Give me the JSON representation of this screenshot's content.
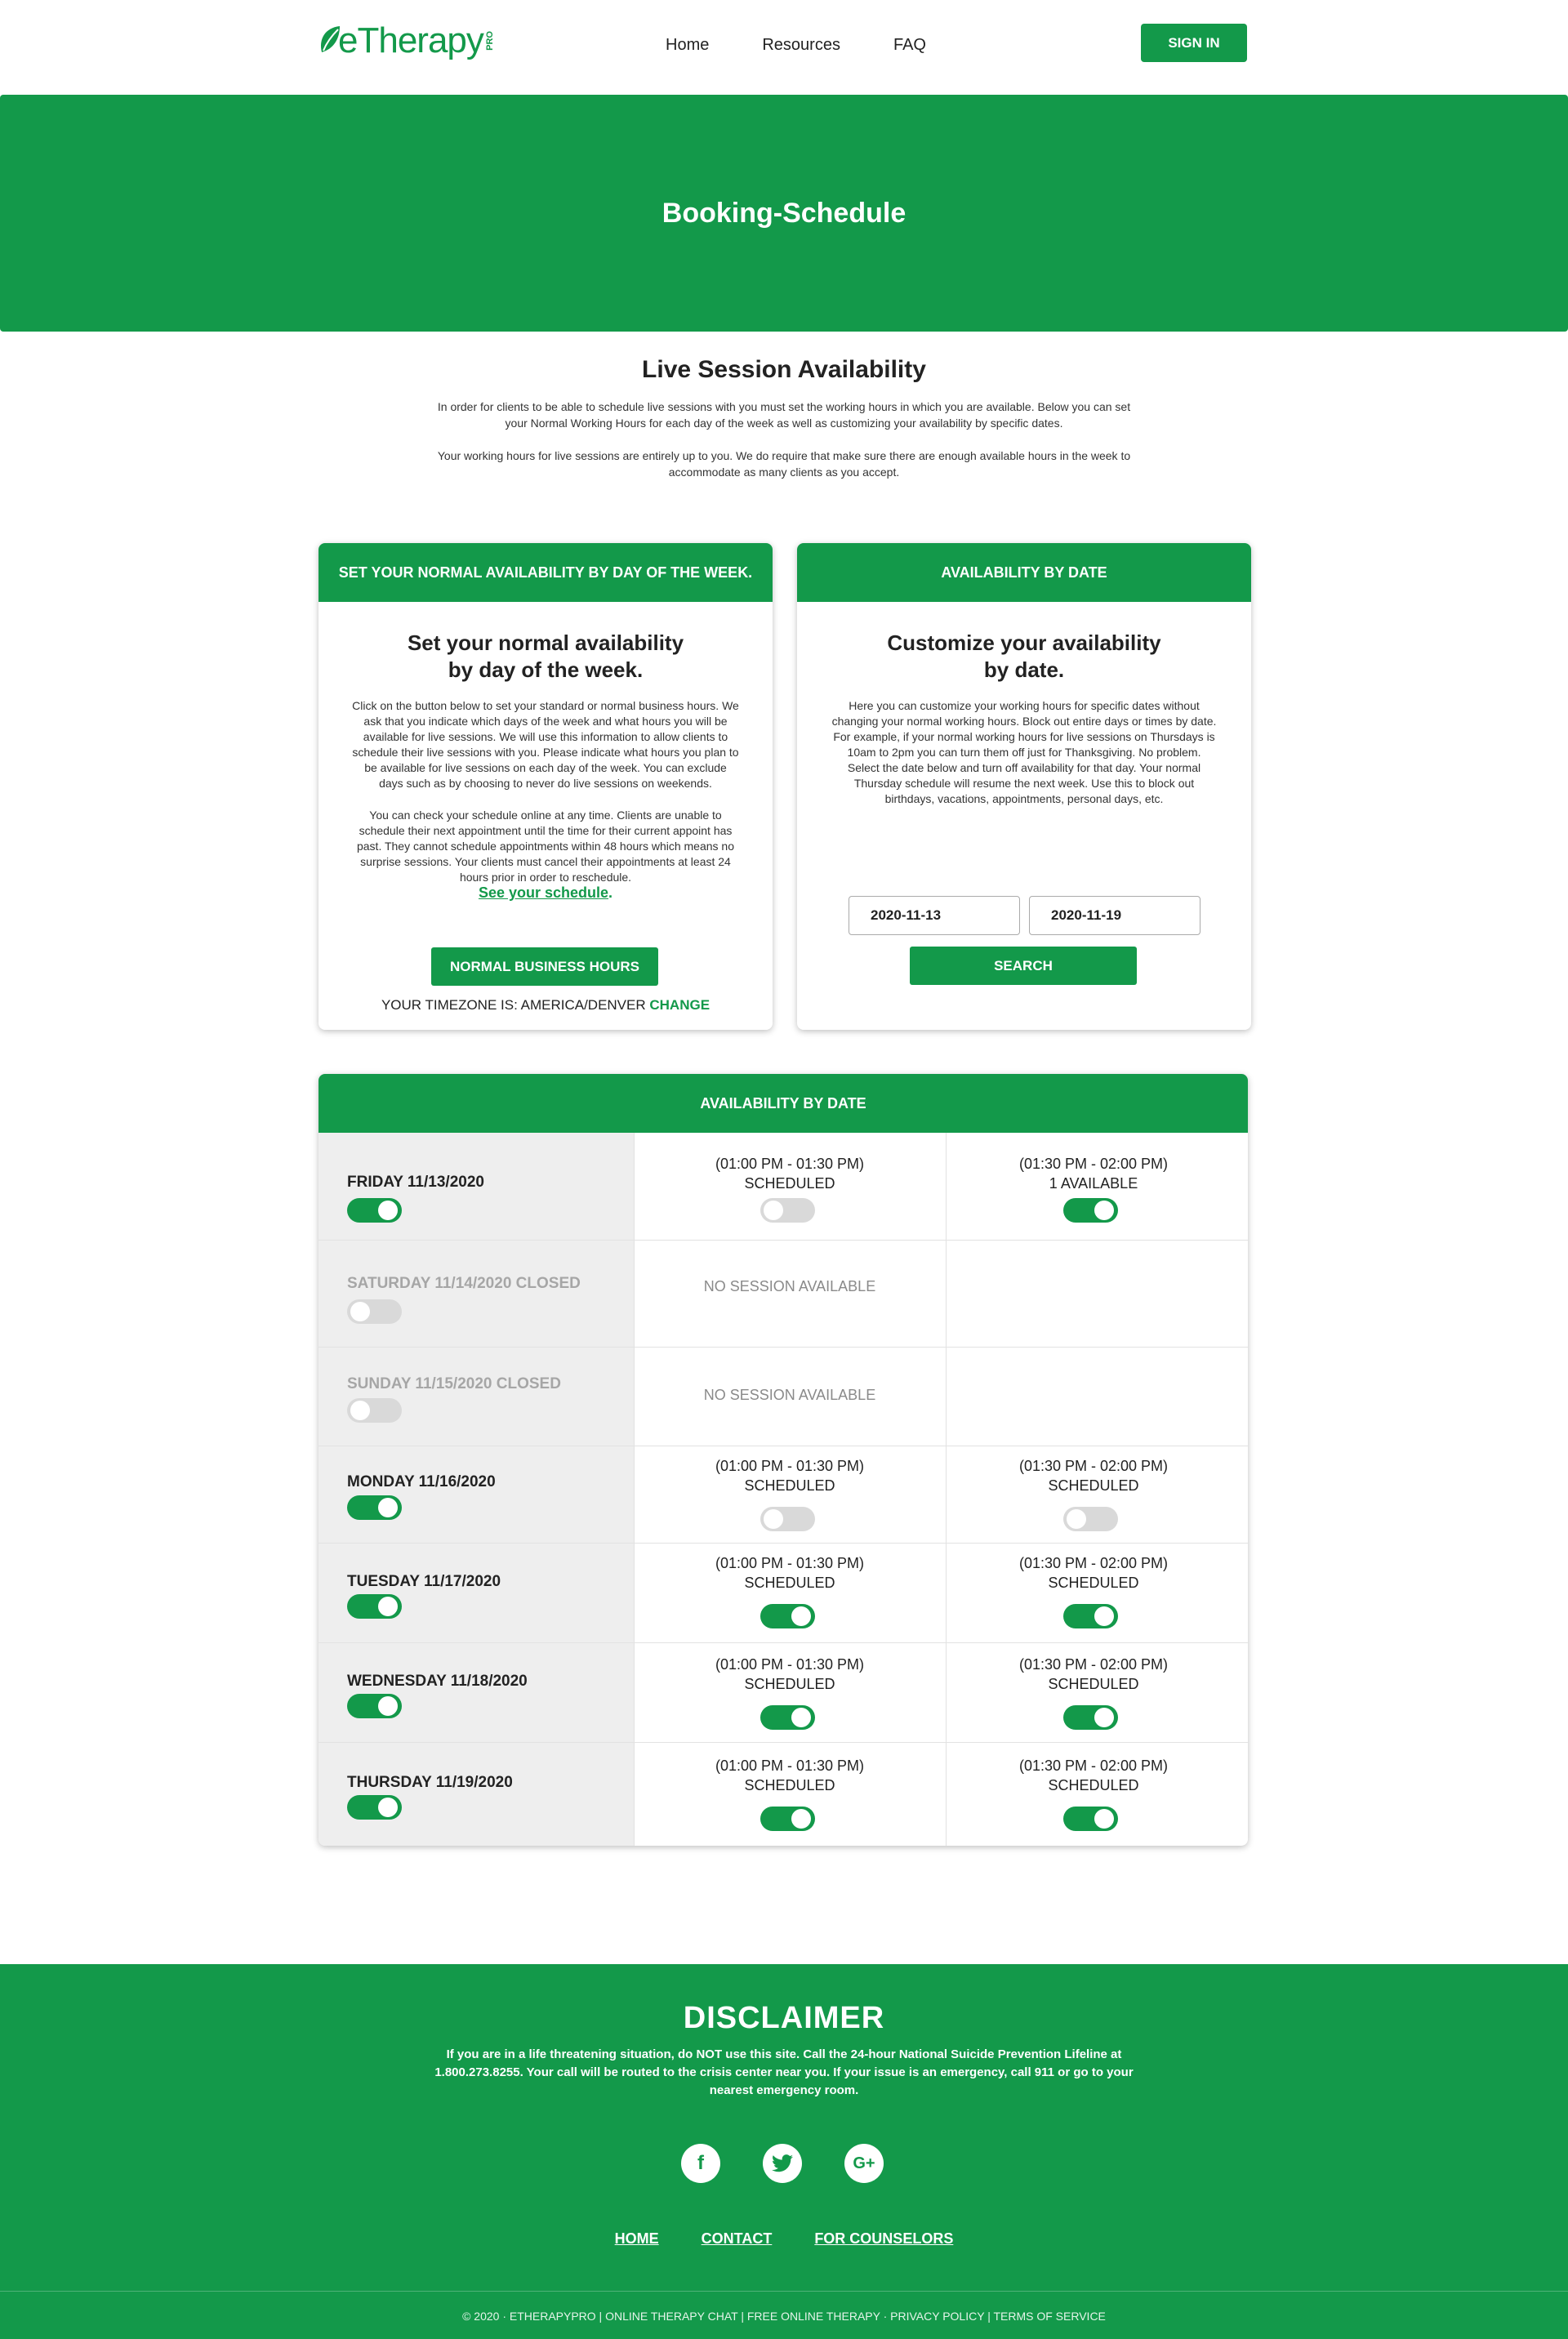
{
  "header": {
    "logo_text": "eTherapy",
    "logo_suffix": "PRO",
    "nav": [
      "Home",
      "Resources",
      "FAQ"
    ],
    "signin_label": "SIGN IN"
  },
  "hero": {
    "title": "Booking-Schedule"
  },
  "intro": {
    "title": "Live Session Availability",
    "p1": "In order for clients to be able to schedule live sessions with you must set the working hours in which you are available. Below you can set your Normal Working Hours for each day of the week as well as customizing your availability by specific dates.",
    "p2": "Your working hours for live sessions are entirely up to you. We do require that make sure there are enough available hours in the week to accommodate as many clients as you accept."
  },
  "left_card": {
    "header": "SET YOUR NORMAL AVAILABILITY BY DAY OF THE WEEK.",
    "title": "Set your normal availability by day of the week.",
    "p1": "Click on the button below to set your standard or normal business hours. We ask that you indicate which days of the week and what hours you will be available for live sessions. We will use this information to allow clients to schedule their live sessions with you. Please indicate what hours you plan to be available for live sessions on each day of the week. You can exclude days such as by choosing to never do live sessions on weekends.",
    "p2": "You can check your schedule online at any time. Clients are unable to schedule their next appointment until the time for their current appoint has past. They cannot schedule appointments within 48 hours which means no surprise sessions. Your clients must cancel their appointments at least 24 hours prior in order to reschedule.",
    "schedule_link": "See your schedule",
    "button": "NORMAL BUSINESS HOURS",
    "tz_label": "YOUR TIMEZONE IS:",
    "tz_value": "AMERICA/DENVER",
    "tz_change": "CHANGE"
  },
  "right_card": {
    "header": "AVAILABILITY BY DATE",
    "title": "Customize your availability by date.",
    "p1": "Here you can customize your working hours for specific dates without changing your normal working hours. Block out entire days or times by date. For example, if your normal working hours for live sessions on Thursdays is 10am to 2pm you can turn them off just for Thanksgiving. No problem. Select the date below and turn off availability for that day. Your normal Thursday schedule will resume the next week. Use this to block out birthdays, vacations, appointments, personal days, etc.",
    "date_from": "2020-11-13",
    "date_to": "2020-11-19",
    "button": "SEARCH"
  },
  "table": {
    "header": "AVAILABILITY BY DATE",
    "no_session": "NO SESSION AVAILABLE",
    "rows": [
      {
        "day": "FRIDAY 11/13/2020",
        "closed": false,
        "day_on": true,
        "s1": {
          "time": "(01:00 PM - 01:30 PM)",
          "status": "SCHEDULED",
          "on": false
        },
        "s2": {
          "time": "(01:30 PM - 02:00 PM)",
          "status": "1 AVAILABLE",
          "on": true
        }
      },
      {
        "day": "SATURDAY 11/14/2020 CLOSED",
        "closed": true,
        "day_on": false
      },
      {
        "day": "SUNDAY 11/15/2020 CLOSED",
        "closed": true,
        "day_on": false
      },
      {
        "day": "MONDAY 11/16/2020",
        "closed": false,
        "day_on": true,
        "s1": {
          "time": "(01:00 PM - 01:30 PM)",
          "status": "SCHEDULED",
          "on": false
        },
        "s2": {
          "time": "(01:30 PM - 02:00 PM)",
          "status": "SCHEDULED",
          "on": false
        }
      },
      {
        "day": "TUESDAY 11/17/2020",
        "closed": false,
        "day_on": true,
        "s1": {
          "time": "(01:00 PM - 01:30 PM)",
          "status": "SCHEDULED",
          "on": true
        },
        "s2": {
          "time": "(01:30 PM - 02:00 PM)",
          "status": "SCHEDULED",
          "on": true
        }
      },
      {
        "day": "WEDNESDAY 11/18/2020",
        "closed": false,
        "day_on": true,
        "s1": {
          "time": "(01:00 PM - 01:30 PM)",
          "status": "SCHEDULED",
          "on": true
        },
        "s2": {
          "time": "(01:30 PM - 02:00 PM)",
          "status": "SCHEDULED",
          "on": true
        }
      },
      {
        "day": "THURSDAY 11/19/2020",
        "closed": false,
        "day_on": true,
        "s1": {
          "time": "(01:00 PM - 01:30 PM)",
          "status": "SCHEDULED",
          "on": true
        },
        "s2": {
          "time": "(01:30 PM - 02:00 PM)",
          "status": "SCHEDULED",
          "on": true
        }
      }
    ]
  },
  "footer": {
    "title": "DISCLAIMER",
    "text": "If you are in a life threatening situation, do NOT use this site. Call the 24-hour National Suicide Prevention Lifeline at 1.800.273.8255. Your call will be routed to the crisis center near you. If your issue is an emergency, call 911 or go to your nearest emergency room.",
    "social": [
      "facebook-icon",
      "twitter-icon",
      "google-plus-icon"
    ],
    "links": [
      "HOME",
      "CONTACT",
      "FOR COUNSELORS"
    ],
    "copyright": "© 2020 · ETHERAPYPRO | ONLINE THERAPY CHAT | FREE ONLINE THERAPY · PRIVACY POLICY | TERMS OF SERVICE"
  },
  "colors": {
    "brand": "#13994a",
    "day_column": "#eeeeee",
    "toggle_off": "#d9d9d9"
  }
}
